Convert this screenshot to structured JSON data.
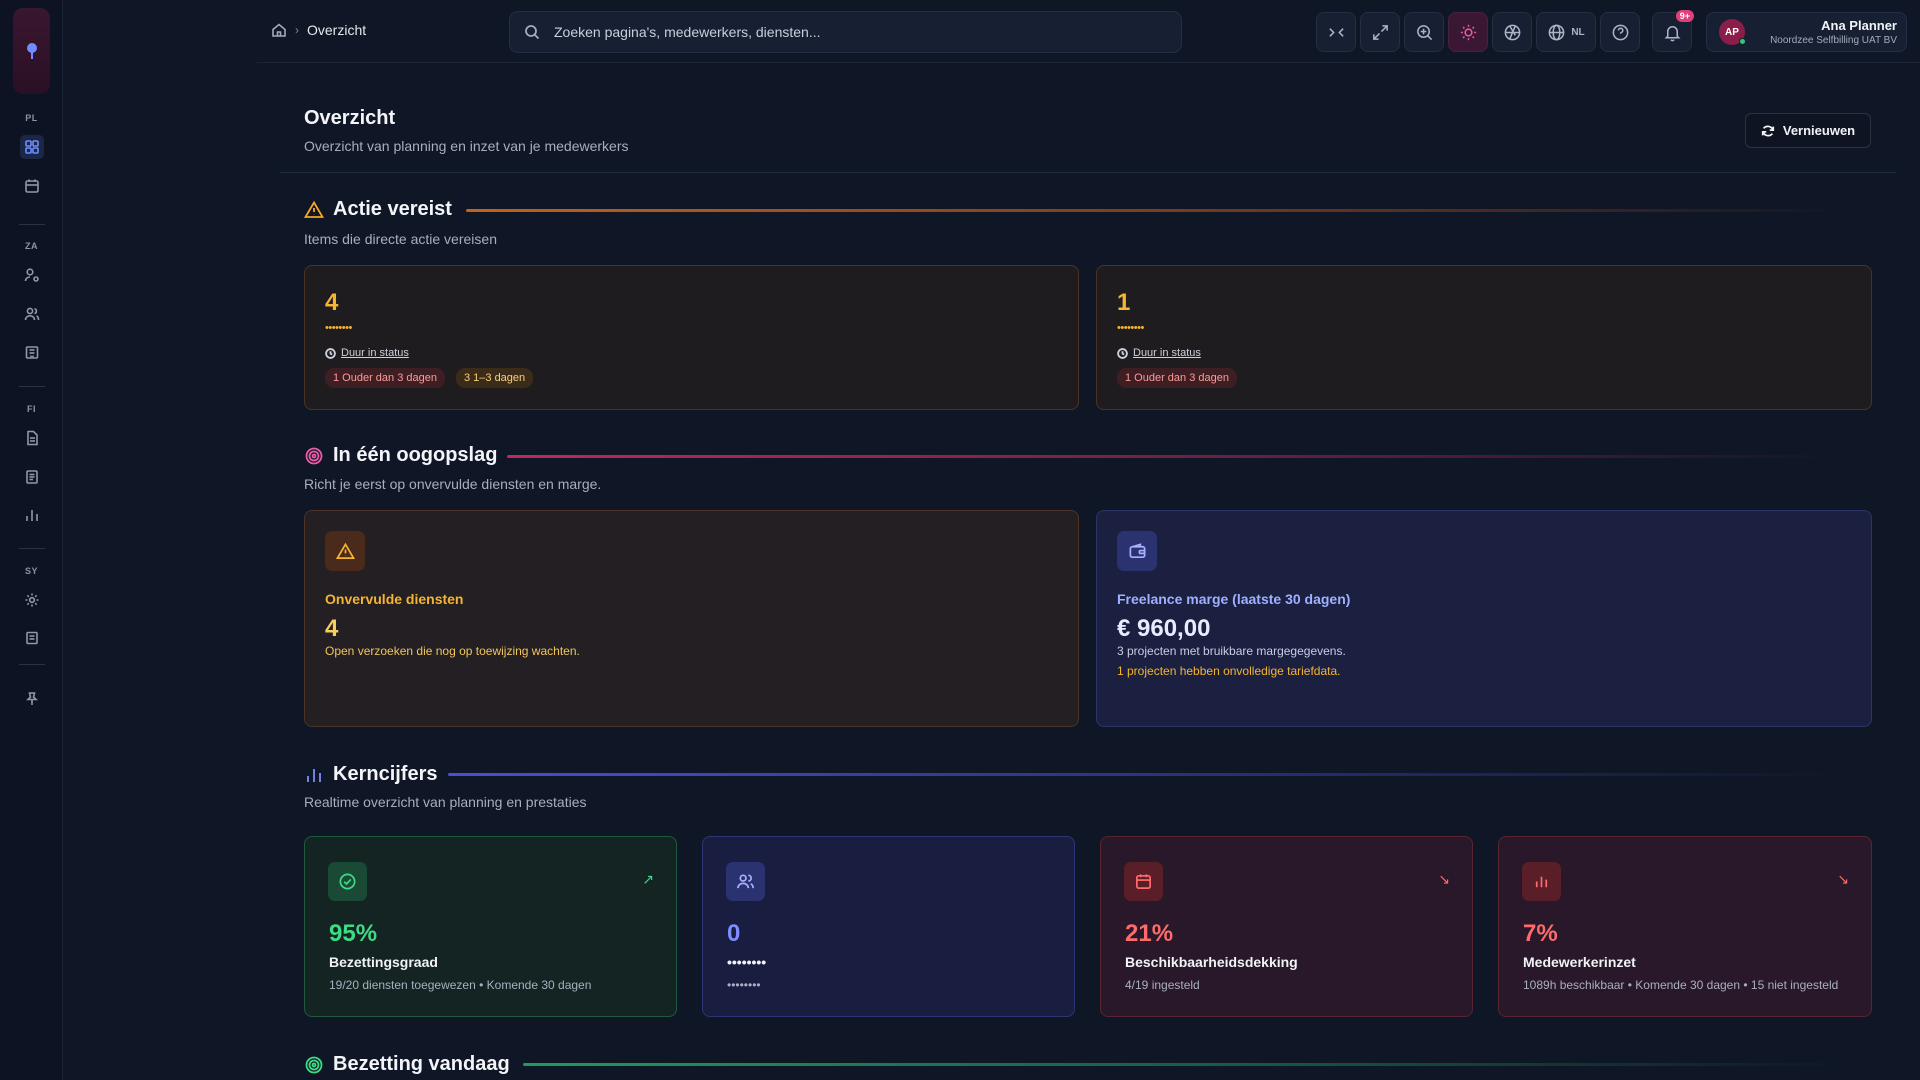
{
  "sidebar": {
    "sections": [
      "PL",
      "ZA",
      "FI",
      "SY"
    ]
  },
  "topbar": {
    "breadcrumb": "Overzicht",
    "search_placeholder": "Zoeken pagina's, medewerkers, diensten...",
    "language": "NL",
    "notifications_badge": "9+",
    "user": {
      "initials": "AP",
      "name": "Ana Planner",
      "org": "Noordzee Selfbilling UAT BV"
    }
  },
  "page": {
    "title": "Overzicht",
    "subtitle": "Overzicht van planning en inzet van je medewerkers",
    "refresh_label": "Vernieuwen"
  },
  "action": {
    "title": "Actie vereist",
    "subtitle": "Items die directe actie vereisen",
    "cards": [
      {
        "count": "4",
        "label": "••••••••",
        "duration_label": "Duur in status",
        "pills": [
          "1 Ouder dan 3 dagen",
          "3 1–3 dagen"
        ]
      },
      {
        "count": "1",
        "label": "••••••••",
        "duration_label": "Duur in status",
        "pills": [
          "1 Ouder dan 3 dagen"
        ]
      }
    ]
  },
  "glance": {
    "title": "In één oogopslag",
    "subtitle": "Richt je eerst op onvervulde diensten en marge.",
    "unfilled": {
      "title": "Onvervulde diensten",
      "value": "4",
      "desc": "Open verzoeken die nog op toewijzing wachten."
    },
    "margin": {
      "title": "Freelance marge (laatste 30 dagen)",
      "value": "€ 960,00",
      "desc1": "3 projecten met bruikbare margegegevens.",
      "desc2": "1 projecten hebben onvolledige tariefdata."
    }
  },
  "kpi": {
    "title": "Kerncijfers",
    "subtitle": "Realtime overzicht van planning en prestaties",
    "cards": [
      {
        "value": "95%",
        "label": "Bezettingsgraad",
        "desc": "19/20 diensten toegewezen • Komende 30 dagen",
        "trend": "up",
        "color": "#3ddc84"
      },
      {
        "value": "0",
        "label": "••••••••",
        "desc": "••••••••",
        "trend": "",
        "color": "#7e8cff"
      },
      {
        "value": "21%",
        "label": "Beschikbaarheidsdekking",
        "desc": "4/19 ingesteld",
        "trend": "down",
        "color": "#ff6b6b"
      },
      {
        "value": "7%",
        "label": "Medewerkerinzet",
        "desc": "1089h beschikbaar • Komende 30 dagen • 15 niet ingesteld",
        "trend": "down",
        "color": "#ff6b6b"
      }
    ]
  },
  "occupancy": {
    "title": "Bezetting vandaag"
  },
  "colors": {
    "amber": "#f5b432",
    "pink": "#ea5ba8",
    "indigo": "#6f7dff",
    "green": "#3ddc84",
    "red": "#ff6b6b"
  }
}
